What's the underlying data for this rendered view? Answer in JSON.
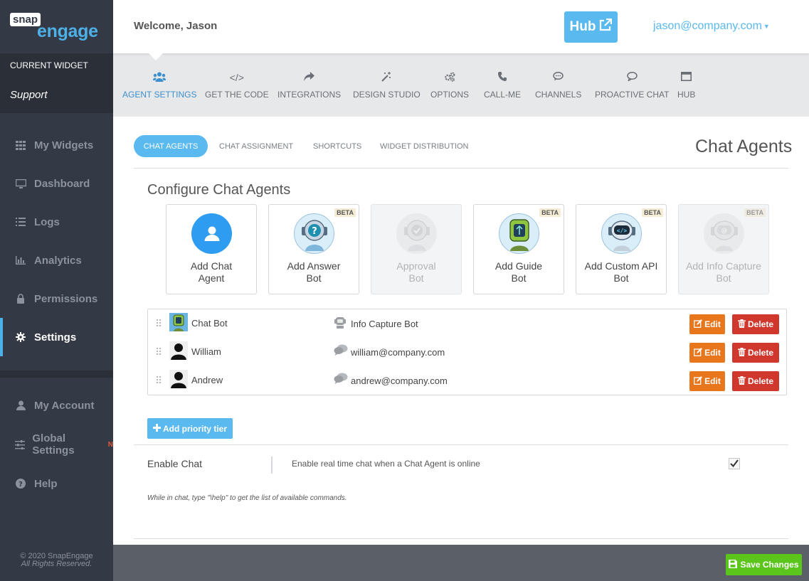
{
  "logo": {
    "part1": "snap",
    "part2": "engage"
  },
  "sidebar": {
    "current_widget_label": "CURRENT WIDGET",
    "current_widget_name": "Support",
    "items": [
      {
        "label": "My Widgets",
        "icon": "grid-icon"
      },
      {
        "label": "Dashboard",
        "icon": "monitor-icon"
      },
      {
        "label": "Logs",
        "icon": "list-icon"
      },
      {
        "label": "Analytics",
        "icon": "bar-chart-icon"
      },
      {
        "label": "Permissions",
        "icon": "lock-icon"
      },
      {
        "label": "Settings",
        "icon": "gear-icon",
        "active": true
      },
      {
        "label": "My Account",
        "icon": "user-icon"
      },
      {
        "label": "Global Settings",
        "icon": "sliders-icon",
        "badge": "N"
      },
      {
        "label": "Help",
        "icon": "question-icon"
      }
    ],
    "copyright_line1": "© 2020 SnapEngage",
    "copyright_line2": "All Rights Reserved."
  },
  "header": {
    "welcome": "Welcome, Jason",
    "hub_label": "Hub",
    "user_email": "jason@company.com"
  },
  "main_tabs": [
    {
      "label": "AGENT SETTINGS",
      "icon": "users-icon",
      "active": true
    },
    {
      "label": "GET THE CODE",
      "icon": "code-icon"
    },
    {
      "label": "INTEGRATIONS",
      "icon": "share-icon"
    },
    {
      "label": "DESIGN STUDIO",
      "icon": "magic-wand-icon"
    },
    {
      "label": "OPTIONS",
      "icon": "gears-icon"
    },
    {
      "label": "CALL-ME",
      "icon": "phone-icon"
    },
    {
      "label": "CHANNELS",
      "icon": "chat-bubble-icon"
    },
    {
      "label": "PROACTIVE CHAT",
      "icon": "chat-outline-icon"
    },
    {
      "label": "HUB",
      "icon": "window-icon"
    }
  ],
  "sub_tabs": [
    {
      "label": "CHAT AGENTS",
      "active": true
    },
    {
      "label": "CHAT ASSIGNMENT"
    },
    {
      "label": "SHORTCUTS"
    },
    {
      "label": "WIDGET DISTRIBUTION"
    }
  ],
  "page_heading": "Chat Agents",
  "configure_title": "Configure Chat Agents",
  "cards": [
    {
      "label_line1": "Add Chat",
      "label_line2": "Agent",
      "beta": "",
      "disabled": false,
      "icon": "user-circle-icon"
    },
    {
      "label_line1": "Add Answer",
      "label_line2": "Bot",
      "beta": "BETA",
      "disabled": false,
      "icon": "answer-bot-icon"
    },
    {
      "label_line1": "Approval",
      "label_line2": "Bot",
      "beta": "",
      "disabled": true,
      "icon": "approval-bot-icon"
    },
    {
      "label_line1": "Add Guide",
      "label_line2": "Bot",
      "beta": "BETA",
      "disabled": false,
      "icon": "guide-bot-icon"
    },
    {
      "label_line1": "Add Custom API",
      "label_line2": "Bot",
      "beta": "BETA",
      "disabled": false,
      "icon": "custom-api-bot-icon"
    },
    {
      "label_line1": "Add Info Capture",
      "label_line2": "Bot",
      "beta": "BETA",
      "disabled": true,
      "icon": "info-capture-bot-icon"
    }
  ],
  "agents": [
    {
      "name": "Chat Bot",
      "type": "Info Capture Bot",
      "avatar": "bot-avatar-icon",
      "type_icon": "robot-icon"
    },
    {
      "name": "William",
      "type": "william@company.com",
      "avatar": "person-silhouette-icon",
      "type_icon": "chat-agent-icon"
    },
    {
      "name": "Andrew",
      "type": "andrew@company.com",
      "avatar": "person-silhouette-icon",
      "type_icon": "chat-agent-icon"
    }
  ],
  "buttons": {
    "edit": "Edit",
    "delete": "Delete",
    "add_priority_tier": "Add priority tier",
    "save_changes": "Save Changes"
  },
  "enable_chat": {
    "label": "Enable Chat",
    "description": "Enable real time chat when a Chat Agent is online",
    "checked": true,
    "hint": "While in chat, type \"\\help\" to get the list of available commands."
  },
  "colors": {
    "sidebar_bg": "#343a45",
    "accent_blue": "#5ab9ef",
    "edit_orange": "#e8761c",
    "delete_red": "#d1382d",
    "save_green": "#5bc51c"
  }
}
